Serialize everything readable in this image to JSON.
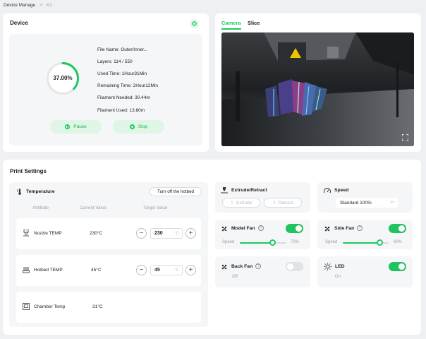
{
  "breadcrumb": {
    "root": "Device Manage",
    "sep": ">",
    "current": "K1"
  },
  "device": {
    "title": "Device",
    "progress_text": "37.00%",
    "progress_fraction": 0.37,
    "info": [
      {
        "label": "File Name:",
        "value": "Outer/Inner..."
      },
      {
        "label": "Layers:",
        "value": "114 / 550"
      },
      {
        "label": "Used Time:",
        "value": "1Hour31Min"
      },
      {
        "label": "Remaining Time:",
        "value": "2Hour12Min"
      },
      {
        "label": "Filament Needed:",
        "value": "30.44m"
      },
      {
        "label": "Filament Used:",
        "value": "13.80m"
      }
    ],
    "pause_label": "Pause",
    "stop_label": "Stop"
  },
  "camera": {
    "tab_camera": "Camera",
    "tab_slice": "Slice"
  },
  "print_settings": {
    "title": "Print Settings",
    "temperature": {
      "title": "Temperature",
      "hotbed_off_label": "Turn off the hotbed",
      "col_attribute": "Attribute",
      "col_current": "Current Value",
      "col_target": "Target Value",
      "rows": [
        {
          "name": "Nozzle TEMP",
          "current": "230°C",
          "target": "230",
          "unit": "°C"
        },
        {
          "name": "Hotbed TEMP",
          "current": "45°C",
          "target": "45",
          "unit": "°C"
        },
        {
          "name": "Chamber Temp",
          "current": "31°C"
        }
      ]
    },
    "extrude": {
      "title": "Extrude/Retract",
      "extrude_label": "Extrude",
      "retract_label": "Retract"
    },
    "speed": {
      "title": "Speed",
      "selected": "Standard 100%"
    },
    "model_fan": {
      "title": "Model Fan",
      "speed_label": "Speed",
      "value_text": "70%",
      "value": 0.7,
      "on": true
    },
    "side_fan": {
      "title": "Side Fan",
      "speed_label": "Speed",
      "value_text": "80%",
      "value": 0.8,
      "on": true
    },
    "back_fan": {
      "title": "Back Fan",
      "status": "Off",
      "on": false
    },
    "led": {
      "title": "LED",
      "status": "On",
      "on": true
    }
  },
  "colors": {
    "accent": "#1ec85f"
  }
}
